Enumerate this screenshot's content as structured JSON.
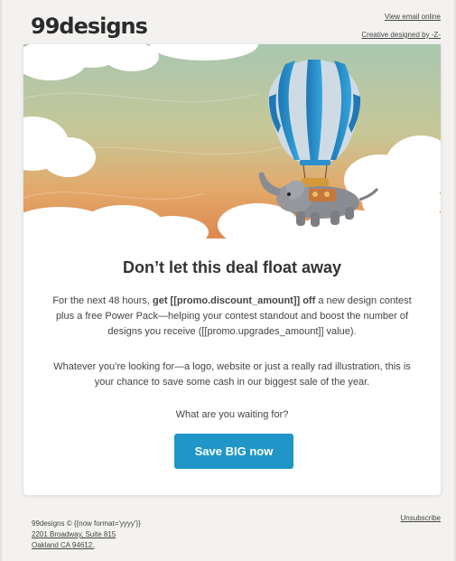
{
  "header": {
    "logo": "99designs",
    "view_online_link": "View email online",
    "creative_credit_link": "Creative designed by -Z-"
  },
  "hero": {
    "image": "illustration-hot-air-balloon-elephant-above-clouds",
    "colors": {
      "sky_top": "#a8c8b2",
      "sky_bottom": "#e69a5a",
      "balloon_blue": "#2a8fcf",
      "balloon_light": "#cfdbe4",
      "cloud": "#ffffff"
    }
  },
  "content": {
    "headline": "Don’t let this deal float away",
    "p1_pre": "For the next 48 hours, ",
    "p1_bold": "get [[promo.discount_amount]] off",
    "p1_post": " a new design contest plus a free Power Pack—helping your contest standout and boost the number of designs you receive ([[promo.upgrades_amount]] value).",
    "p2": "Whatever you’re looking for—a logo, website or just a really rad illustration, this is your chance to save some cash in our biggest sale of the year.",
    "question": "What are you waiting for?",
    "cta_label": "Save BIG now",
    "cta_color": "#1f96c7"
  },
  "footer": {
    "copyright": "99designs © {{now format='yyyy'}}",
    "address_line1": "2201 Broadway, Suite 815",
    "address_line2": "Oakland CA 94612.",
    "unsubscribe": "Unsubscribe"
  }
}
